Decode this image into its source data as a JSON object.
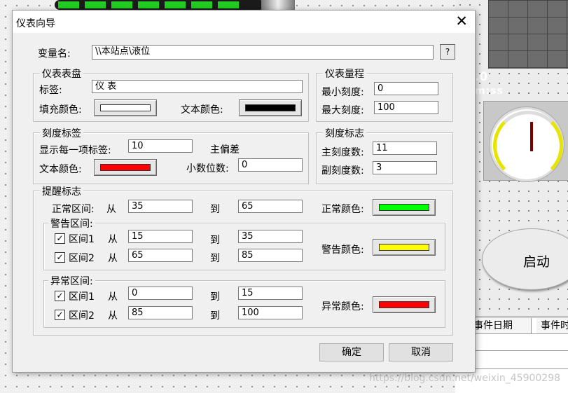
{
  "background": {
    "texts": {
      "t1": ".0",
      "t2": "m:ss"
    },
    "start_button": "启动",
    "table_headers": [
      "事件日期",
      "事件时"
    ],
    "watermark": "https://blog.csdn.net/weixin_45900298"
  },
  "dialog": {
    "title": "仪表向导",
    "variable": {
      "label": "变量名:",
      "value": "\\\\本站点\\液位",
      "help_btn": "?"
    },
    "dial": {
      "group": "仪表表盘",
      "tag_label": "标签:",
      "tag_value": "仪 表",
      "fill_label": "填充颜色:",
      "fill_color": "#ffffff",
      "text_label": "文本颜色:",
      "text_color": "#000000"
    },
    "range": {
      "group": "仪表量程",
      "min_label": "最小刻度:",
      "min_value": "0",
      "max_label": "最大刻度:",
      "max_value": "100"
    },
    "scale_label": {
      "group": "刻度标签",
      "every_label": "显示每一项标签:",
      "every_value": "10",
      "offset_label": "主偏差",
      "text_label": "文本颜色:",
      "text_color": "#ff0000",
      "decimals_label": "小数位数:",
      "decimals_value": "0"
    },
    "scale_mark": {
      "group": "刻度标志",
      "major_label": "主刻度数:",
      "major_value": "11",
      "minor_label": "副刻度数:",
      "minor_value": "3"
    },
    "alarm": {
      "group": "提醒标志",
      "from": "从",
      "to": "到",
      "normal": {
        "label": "正常区间:",
        "from_value": "35",
        "to_value": "65",
        "color_label": "正常颜色:",
        "color": "#00ff00"
      },
      "warning": {
        "group": "警告区间:",
        "color_label": "警告颜色:",
        "color": "#ffff00",
        "zones": [
          {
            "check": "✓",
            "label": "区间1",
            "from_value": "15",
            "to_value": "35"
          },
          {
            "check": "✓",
            "label": "区间2",
            "from_value": "65",
            "to_value": "85"
          }
        ]
      },
      "abnormal": {
        "group": "异常区间:",
        "color_label": "异常颜色:",
        "color": "#ff0000",
        "zones": [
          {
            "check": "✓",
            "label": "区间1",
            "from_value": "0",
            "to_value": "15"
          },
          {
            "check": "✓",
            "label": "区间2",
            "from_value": "85",
            "to_value": "100"
          }
        ]
      }
    },
    "ok_label": "确定",
    "cancel_label": "取消"
  }
}
